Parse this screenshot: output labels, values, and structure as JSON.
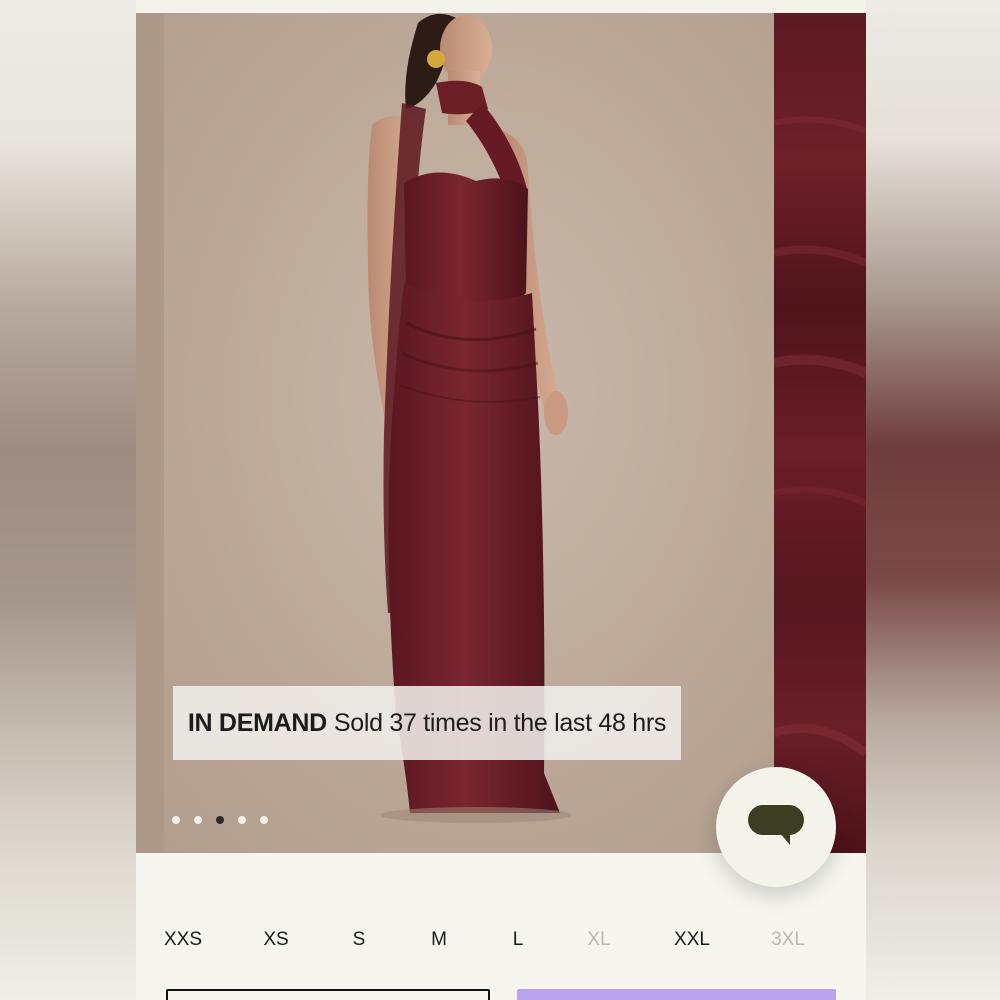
{
  "product_images": {
    "main_image": "model wearing burgundy halter maxi dress with scarf",
    "next_image": "burgundy fabric close-up",
    "dress_color": "#6a1f28",
    "backdrop_color": "#bba898"
  },
  "badge": {
    "strong": "IN DEMAND",
    "text": "Sold 37 times in the last 48 hrs"
  },
  "carousel": {
    "dot_count": 5,
    "active_index": 2
  },
  "chat": {
    "icon": "chat-bubble-icon",
    "icon_color": "#3d3d22"
  },
  "sizes": [
    {
      "label": "XXS",
      "available": true
    },
    {
      "label": "XS",
      "available": true
    },
    {
      "label": "S",
      "available": true
    },
    {
      "label": "M",
      "available": true
    },
    {
      "label": "L",
      "available": true
    },
    {
      "label": "XL",
      "available": false
    },
    {
      "label": "XXL",
      "available": true
    },
    {
      "label": "3XL",
      "available": false
    }
  ],
  "colors": {
    "accent_button": "#b9a3ee",
    "disabled_size": "#b9b9b2"
  }
}
